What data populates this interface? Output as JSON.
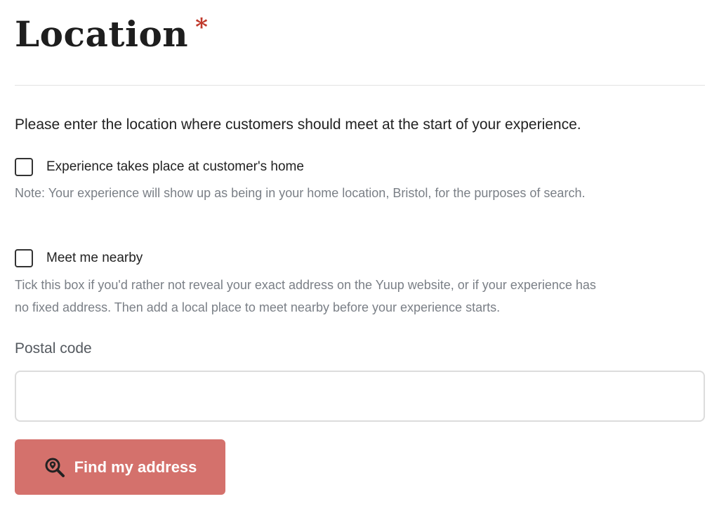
{
  "header": {
    "title": "Location",
    "required_mark": "*"
  },
  "intro_text": "Please enter the location where customers should meet at the start of your experience.",
  "options": [
    {
      "label": "Experience takes place at customer's home",
      "checked": false,
      "note": "Note: Your experience will show up as being in your home location, Bristol, for the purposes of search."
    },
    {
      "label": "Meet me nearby",
      "checked": false,
      "note_line1": "Tick this box if you'd rather not reveal your exact address on the Yuup website, or if your experience has",
      "note_line2": "no fixed address. Then add a local place to meet nearby before your experience starts."
    }
  ],
  "postal_code": {
    "label": "Postal code",
    "value": "",
    "placeholder": ""
  },
  "find_button": {
    "label": "Find my address",
    "icon": "search-location-icon"
  },
  "colors": {
    "required": "#c0392b",
    "button_bg": "#d4716c",
    "muted_text": "#7a7f86"
  }
}
